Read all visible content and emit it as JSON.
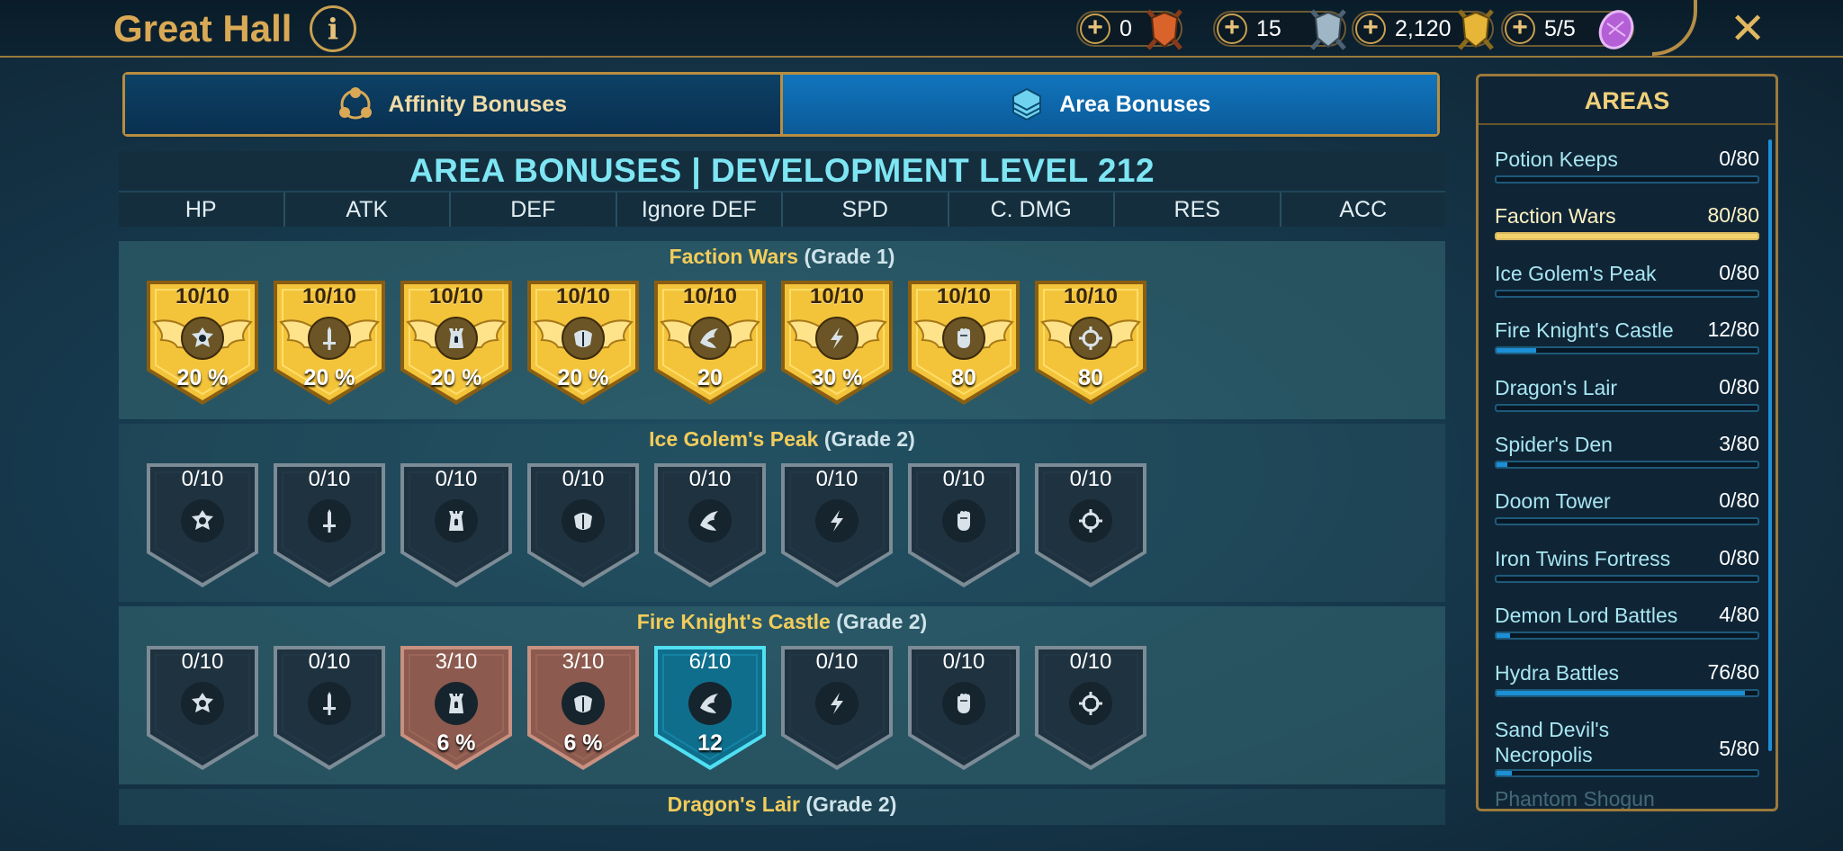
{
  "header": {
    "title": "Great Hall",
    "info_label": "i",
    "close_label": "✕",
    "resources": [
      {
        "value": "0",
        "icon": "orange-shield-icon",
        "color": "#d9632b"
      },
      {
        "value": "15",
        "icon": "silver-shield-icon",
        "color": "#9fb6c6"
      },
      {
        "value": "2,120",
        "icon": "gold-shield-icon",
        "color": "#e7b638"
      },
      {
        "value": "5/5",
        "icon": "purple-gem-icon",
        "color": "#b45fd6"
      }
    ]
  },
  "tabs": [
    {
      "label": "Affinity Bonuses",
      "icon": "affinity-icon"
    },
    {
      "label": "Area Bonuses",
      "icon": "area-icon"
    }
  ],
  "main": {
    "title": "AREA BONUSES | DEVELOPMENT LEVEL 212",
    "columns": [
      "HP",
      "ATK",
      "DEF",
      "Ignore DEF",
      "SPD",
      "C. DMG",
      "RES",
      "ACC"
    ],
    "sections": [
      {
        "name": "Faction Wars",
        "grade": "(Grade 1)",
        "badges": [
          {
            "level": "10/10",
            "value": "20 %",
            "state": "gold"
          },
          {
            "level": "10/10",
            "value": "20 %",
            "state": "gold"
          },
          {
            "level": "10/10",
            "value": "20 %",
            "state": "gold"
          },
          {
            "level": "10/10",
            "value": "20 %",
            "state": "gold"
          },
          {
            "level": "10/10",
            "value": "20",
            "state": "gold"
          },
          {
            "level": "10/10",
            "value": "30 %",
            "state": "gold"
          },
          {
            "level": "10/10",
            "value": "80",
            "state": "gold"
          },
          {
            "level": "10/10",
            "value": "80",
            "state": "gold"
          }
        ]
      },
      {
        "name": "Ice Golem's Peak",
        "grade": "(Grade 2)",
        "badges": [
          {
            "level": "0/10",
            "value": "",
            "state": "empty"
          },
          {
            "level": "0/10",
            "value": "",
            "state": "empty"
          },
          {
            "level": "0/10",
            "value": "",
            "state": "empty"
          },
          {
            "level": "0/10",
            "value": "",
            "state": "empty"
          },
          {
            "level": "0/10",
            "value": "",
            "state": "empty"
          },
          {
            "level": "0/10",
            "value": "",
            "state": "empty"
          },
          {
            "level": "0/10",
            "value": "",
            "state": "empty"
          },
          {
            "level": "0/10",
            "value": "",
            "state": "empty"
          }
        ]
      },
      {
        "name": "Fire Knight's Castle",
        "grade": "(Grade 2)",
        "badges": [
          {
            "level": "0/10",
            "value": "",
            "state": "empty"
          },
          {
            "level": "0/10",
            "value": "",
            "state": "empty"
          },
          {
            "level": "3/10",
            "value": "6 %",
            "state": "bronze"
          },
          {
            "level": "3/10",
            "value": "6 %",
            "state": "bronze"
          },
          {
            "level": "6/10",
            "value": "12",
            "state": "blue"
          },
          {
            "level": "0/10",
            "value": "",
            "state": "empty"
          },
          {
            "level": "0/10",
            "value": "",
            "state": "empty"
          },
          {
            "level": "0/10",
            "value": "",
            "state": "empty"
          }
        ]
      },
      {
        "name": "Dragon's Lair",
        "grade": "(Grade 2)"
      }
    ],
    "stat_icons": [
      "hp-icon",
      "atk-icon",
      "def-icon",
      "ignore-def-icon",
      "spd-icon",
      "crit-dmg-icon",
      "res-icon",
      "acc-icon"
    ]
  },
  "sidebar": {
    "title": "AREAS",
    "items": [
      {
        "name": "Potion Keeps",
        "count": "0/80",
        "progress": 0
      },
      {
        "name": "Faction Wars",
        "count": "80/80",
        "progress": 1,
        "selected": true
      },
      {
        "name": "Ice Golem's Peak",
        "count": "0/80",
        "progress": 0
      },
      {
        "name": "Fire Knight's Castle",
        "count": "12/80",
        "progress": 0.15
      },
      {
        "name": "Dragon's Lair",
        "count": "0/80",
        "progress": 0
      },
      {
        "name": "Spider's Den",
        "count": "3/80",
        "progress": 0.04
      },
      {
        "name": "Doom Tower",
        "count": "0/80",
        "progress": 0
      },
      {
        "name": "Iron Twins Fortress",
        "count": "0/80",
        "progress": 0
      },
      {
        "name": "Demon Lord Battles",
        "count": "4/80",
        "progress": 0.05
      },
      {
        "name": "Hydra Battles",
        "count": "76/80",
        "progress": 0.95
      },
      {
        "name": "Sand Devil's Necropolis",
        "count": "5/80",
        "progress": 0.06
      }
    ],
    "more_label": "Phantom Shogun"
  }
}
